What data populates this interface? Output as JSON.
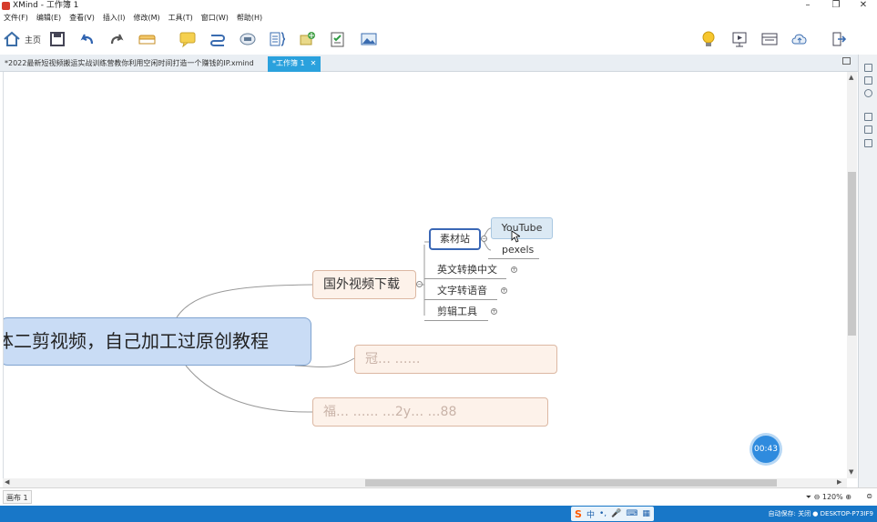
{
  "window": {
    "title": "XMind - 工作簿 1",
    "controls": [
      "–",
      "❐",
      "✕"
    ]
  },
  "menu": [
    "文件(F)",
    "编辑(E)",
    "查看(V)",
    "插入(I)",
    "修改(M)",
    "工具(T)",
    "窗口(W)",
    "帮助(H)"
  ],
  "toolbar": {
    "home_label": "主页"
  },
  "tabs": [
    {
      "label": "*2022最新短视频搬运实战训练营教你利用空闲时间打造一个赚钱的IP.xmind",
      "active": false
    },
    {
      "label": "*工作簿 1",
      "active": true,
      "close": "✕"
    }
  ],
  "mindmap": {
    "central": "体二剪视频，自己加工过原创教程",
    "main_topics": [
      "国外视频下载",
      "冠…  ……",
      "福…  ……  …2y…  …88"
    ],
    "subtopics": [
      "英文转换中文",
      "文字转语音",
      "剪辑工具"
    ],
    "selected_topic": "素材站",
    "leaves": [
      "YouTube",
      "pexels"
    ],
    "expander_symbol": "+",
    "collapse_symbol": "−"
  },
  "timer": "00:43",
  "status": {
    "sheet": "画布 1",
    "zoom": "120%"
  },
  "taskbar": {
    "ime_logo": "S",
    "ime_lang": "中",
    "ime_items": [
      "•,",
      "🎤",
      "⌨",
      "▦"
    ],
    "tray": "自动保存: 关闭 ● DESKTOP-P73IF9"
  }
}
